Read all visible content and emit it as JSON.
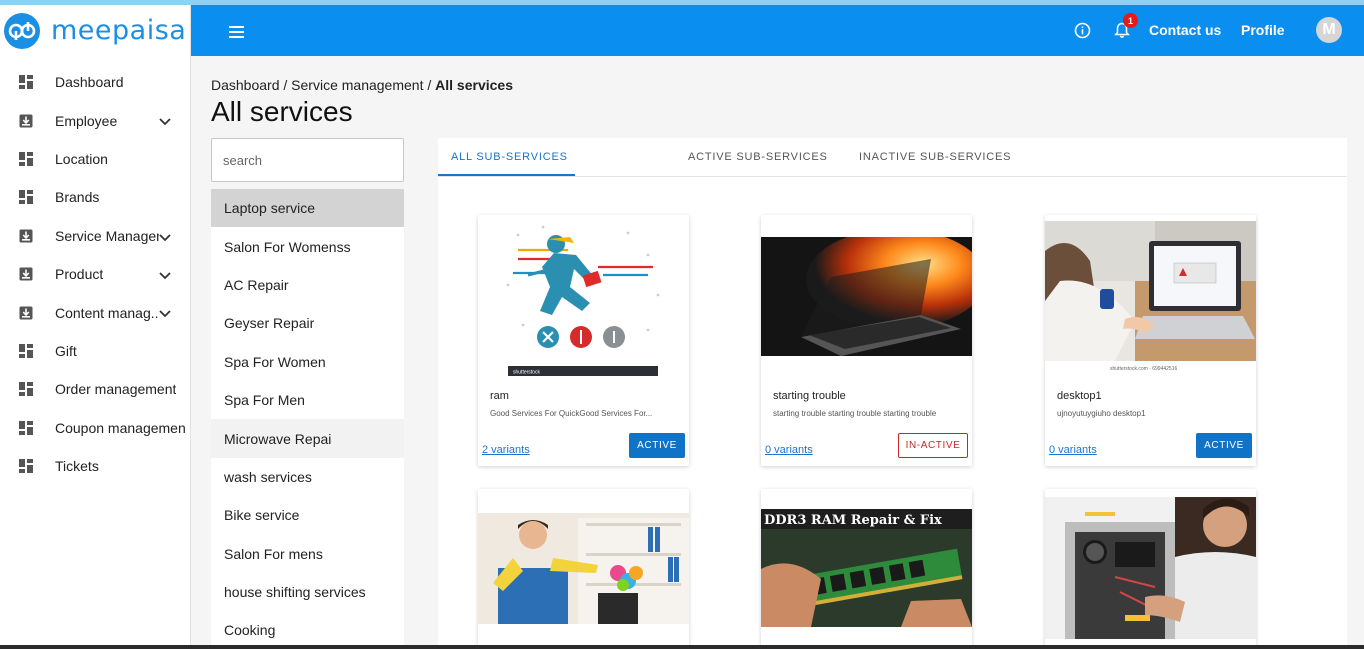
{
  "app": {
    "name": "meepaisa",
    "brand_color": "#0a8ef0"
  },
  "sidebar": {
    "items": [
      {
        "label": "Dashboard",
        "icon": "dashboard-icon",
        "expandable": false
      },
      {
        "label": "Employee",
        "icon": "download-box-icon",
        "expandable": true
      },
      {
        "label": "Location",
        "icon": "dashboard-icon",
        "expandable": false
      },
      {
        "label": "Brands",
        "icon": "dashboard-icon",
        "expandable": false
      },
      {
        "label": "Service Managem",
        "icon": "download-box-icon",
        "expandable": true
      },
      {
        "label": "Product",
        "icon": "download-box-icon",
        "expandable": true
      },
      {
        "label": "Content manag..",
        "icon": "download-box-icon",
        "expandable": true
      },
      {
        "label": "Gift",
        "icon": "dashboard-icon",
        "expandable": false
      },
      {
        "label": "Order management",
        "icon": "dashboard-icon",
        "expandable": false
      },
      {
        "label": "Coupon management",
        "icon": "dashboard-icon",
        "expandable": false
      },
      {
        "label": "Tickets",
        "icon": "dashboard-icon",
        "expandable": false
      }
    ]
  },
  "header": {
    "notification_count": "1",
    "contact_label": "Contact us",
    "profile_label": "Profile",
    "avatar_initial": "M"
  },
  "breadcrumb": {
    "dashboard": "Dashboard",
    "sep": " / ",
    "service_management": "Service management",
    "current": "All services"
  },
  "page": {
    "title": "All services"
  },
  "search": {
    "placeholder": "search",
    "value": ""
  },
  "categories": [
    "Laptop service",
    "Salon For Womenss",
    "AC Repair",
    "Geyser Repair",
    "Spa For Women",
    "Spa For Men",
    "Microwave Repai",
    "wash services",
    "Bike service",
    "Salon For mens",
    "house shifting services",
    "Cooking"
  ],
  "selected_category": "Laptop service",
  "tabs": [
    "ALL SUB-SERVICES",
    "ACTIVE SUB-SERVICES",
    "INACTIVE SUB-SERVICES"
  ],
  "active_tab": "ALL SUB-SERVICES",
  "cards": [
    {
      "title": "ram",
      "description": "Good Services For QuickGood Services For...",
      "variants": "2 variants",
      "status": "ACTIVE",
      "image": "running-repairman-illustration",
      "image_caption": "shutterstock"
    },
    {
      "title": "starting trouble",
      "description": "starting trouble starting trouble starting trouble",
      "variants": "0 variants",
      "status": "IN-ACTIVE",
      "image": "laptop-on-fire-photo"
    },
    {
      "title": "desktop1",
      "description": "ujnoyutuygiuho desktop1",
      "variants": "0 variants",
      "status": "ACTIVE",
      "image": "person-using-laptop-photo",
      "image_caption": "shutterstock.com · 699442516"
    },
    {
      "image": "cleaning-person-photo"
    },
    {
      "image": "ddr3-ram-photo",
      "image_text": "DDR3 RAM  Repair & Fix"
    },
    {
      "image": "desktop-repair-photo"
    }
  ],
  "colors": {
    "accent": "#1173c6",
    "inactive": "#c62828",
    "tab_active": "#1b74c9"
  }
}
